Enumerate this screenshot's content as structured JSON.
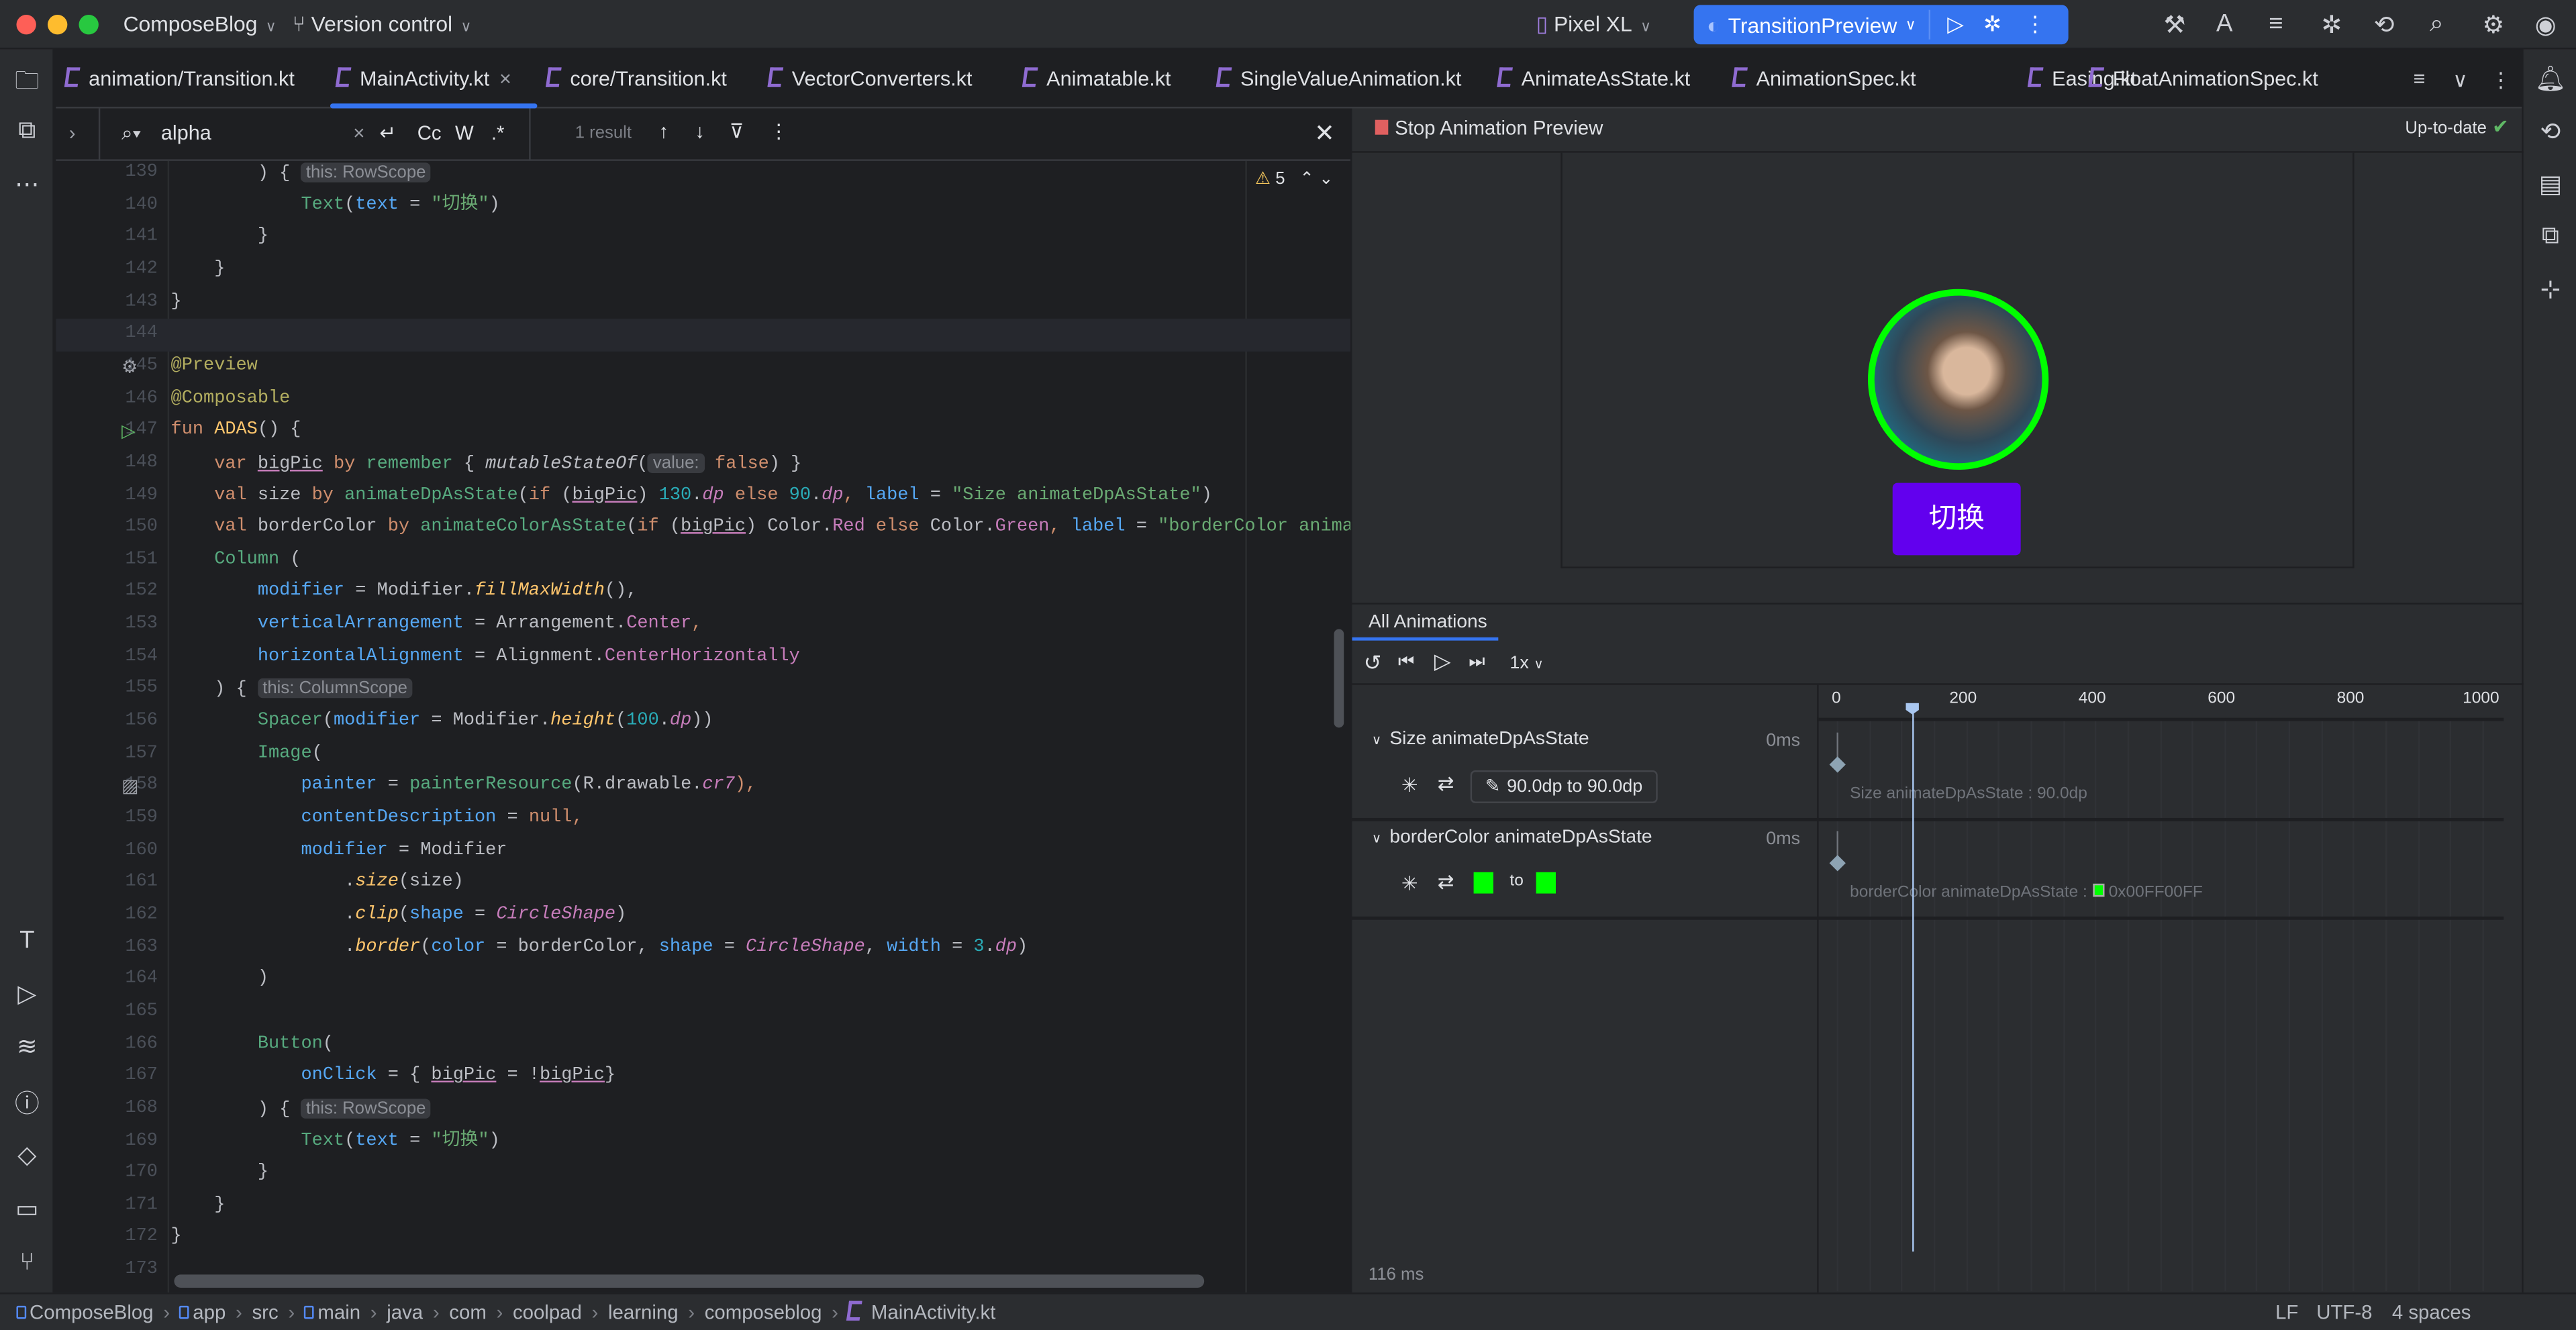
{
  "titlebar": {
    "project": "ComposeBlog",
    "vcs": "Version control",
    "device": "Pixel XL",
    "run_config": "TransitionPreview"
  },
  "tabs": [
    {
      "label": "animation/Transition.kt"
    },
    {
      "label": "MainActivity.kt",
      "active": true
    },
    {
      "label": "core/Transition.kt"
    },
    {
      "label": "VectorConverters.kt"
    },
    {
      "label": "Animatable.kt"
    },
    {
      "label": "SingleValueAnimation.kt"
    },
    {
      "label": "AnimateAsState.kt"
    },
    {
      "label": "AnimationSpec.kt"
    },
    {
      "label": "Easing.kt"
    },
    {
      "label": "FloatAnimationSpec.kt"
    }
  ],
  "find": {
    "query": "alpha",
    "case_label": "Cc",
    "word_label": "W",
    "regex_label": ".*",
    "result": "1 result"
  },
  "editor": {
    "warnings": "5",
    "lines": [
      {
        "n": "139",
        "t": [
          [
            "        ) {",
            "t"
          ],
          [
            " ",
            ""
          ],
          [
            "this: RowScope",
            "h"
          ]
        ]
      },
      {
        "n": "140",
        "t": [
          [
            "            ",
            ""
          ],
          [
            "Text",
            "f"
          ],
          [
            "(",
            ""
          ],
          [
            "text",
            "p"
          ],
          [
            " = ",
            ""
          ],
          [
            "\"切换\"",
            "s"
          ],
          [
            ")",
            ""
          ]
        ]
      },
      {
        "n": "141",
        "t": [
          [
            "        }",
            ""
          ]
        ]
      },
      {
        "n": "142",
        "t": [
          [
            "    }",
            ""
          ]
        ]
      },
      {
        "n": "143",
        "t": [
          [
            "}",
            ""
          ]
        ]
      },
      {
        "n": "144",
        "t": [],
        "cur": true
      },
      {
        "n": "145",
        "t": [
          [
            "@Preview",
            "a"
          ]
        ],
        "icon": "gear"
      },
      {
        "n": "146",
        "t": [
          [
            "@Composable",
            "a"
          ]
        ]
      },
      {
        "n": "147",
        "t": [
          [
            "fun ",
            "k"
          ],
          [
            "ADAS",
            "y"
          ],
          [
            "() {",
            ""
          ]
        ],
        "icon": "run"
      },
      {
        "n": "148",
        "t": [
          [
            "    ",
            ""
          ],
          [
            "var ",
            "k"
          ],
          [
            "bigPic",
            "u"
          ],
          [
            " by ",
            "k"
          ],
          [
            "remember",
            "f"
          ],
          [
            " { ",
            ""
          ],
          [
            "mutableStateOf",
            "i"
          ],
          [
            "(",
            ""
          ],
          [
            "value:",
            "h"
          ],
          [
            " ",
            ""
          ],
          [
            "false",
            "k"
          ],
          [
            ") }",
            ""
          ]
        ]
      },
      {
        "n": "149",
        "t": [
          [
            "    ",
            ""
          ],
          [
            "val ",
            "k"
          ],
          [
            "size",
            ""
          ],
          [
            " by ",
            "k"
          ],
          [
            "animateDpAsState",
            "f"
          ],
          [
            "(",
            ""
          ],
          [
            "if",
            "k"
          ],
          [
            " (",
            ""
          ],
          [
            "bigPic",
            "u"
          ],
          [
            ") ",
            ""
          ],
          [
            "130",
            "n"
          ],
          [
            ".",
            ""
          ],
          [
            "dp",
            "im"
          ],
          [
            " else ",
            "k"
          ],
          [
            "90",
            "n"
          ],
          [
            ".",
            ""
          ],
          [
            "dp",
            "im"
          ],
          [
            ", ",
            "k"
          ],
          [
            "label",
            "p"
          ],
          [
            " = ",
            ""
          ],
          [
            "\"Size animateDpAsState\"",
            "s"
          ],
          [
            ")",
            ""
          ]
        ]
      },
      {
        "n": "150",
        "t": [
          [
            "    ",
            ""
          ],
          [
            "val ",
            "k"
          ],
          [
            "borderColor",
            ""
          ],
          [
            " by ",
            "k"
          ],
          [
            "animateColorAsState",
            "f"
          ],
          [
            "(",
            ""
          ],
          [
            "if",
            "k"
          ],
          [
            " (",
            ""
          ],
          [
            "bigPic",
            "u"
          ],
          [
            ") Color.",
            ""
          ],
          [
            "Red",
            "m"
          ],
          [
            " else ",
            "k"
          ],
          [
            "Color.",
            ""
          ],
          [
            "Green",
            "m"
          ],
          [
            ", ",
            "k"
          ],
          [
            "label",
            "p"
          ],
          [
            " = ",
            ""
          ],
          [
            "\"borderColor animat",
            "s"
          ]
        ]
      },
      {
        "n": "151",
        "t": [
          [
            "    ",
            ""
          ],
          [
            "Column",
            "f"
          ],
          [
            " (",
            ""
          ]
        ]
      },
      {
        "n": "152",
        "t": [
          [
            "        ",
            ""
          ],
          [
            "modifier",
            "p"
          ],
          [
            " = Modifier.",
            ""
          ],
          [
            "fillMaxWidth",
            "e"
          ],
          [
            "(),",
            ""
          ]
        ]
      },
      {
        "n": "153",
        "t": [
          [
            "        ",
            ""
          ],
          [
            "verticalArrangement",
            "p"
          ],
          [
            " = Arrangement.",
            ""
          ],
          [
            "Center",
            "m"
          ],
          [
            ",",
            "k"
          ]
        ]
      },
      {
        "n": "154",
        "t": [
          [
            "        ",
            ""
          ],
          [
            "horizontalAlignment",
            "p"
          ],
          [
            " = Alignment.",
            ""
          ],
          [
            "CenterHorizontally",
            "m"
          ]
        ]
      },
      {
        "n": "155",
        "t": [
          [
            "    ) {",
            ""
          ],
          [
            " ",
            ""
          ],
          [
            "this: ColumnScope",
            "h"
          ]
        ]
      },
      {
        "n": "156",
        "t": [
          [
            "        ",
            ""
          ],
          [
            "Spacer",
            "f"
          ],
          [
            "(",
            ""
          ],
          [
            "modifier",
            "p"
          ],
          [
            " = Modifier.",
            ""
          ],
          [
            "height",
            "e"
          ],
          [
            "(",
            ""
          ],
          [
            "100",
            "n"
          ],
          [
            ".",
            ""
          ],
          [
            "dp",
            "im"
          ],
          [
            "))",
            ""
          ]
        ]
      },
      {
        "n": "157",
        "t": [
          [
            "        ",
            ""
          ],
          [
            "Image",
            "f"
          ],
          [
            "(",
            ""
          ]
        ]
      },
      {
        "n": "158",
        "t": [
          [
            "            ",
            ""
          ],
          [
            "painter",
            "p"
          ],
          [
            " = ",
            ""
          ],
          [
            "painterResource",
            "f"
          ],
          [
            "(R.drawable.",
            ""
          ],
          [
            "cr7",
            "im"
          ],
          [
            "),",
            "k"
          ]
        ],
        "icon": "image"
      },
      {
        "n": "159",
        "t": [
          [
            "            ",
            ""
          ],
          [
            "contentDescription",
            "p"
          ],
          [
            " = ",
            ""
          ],
          [
            "null",
            "k"
          ],
          [
            ",",
            "k"
          ]
        ]
      },
      {
        "n": "160",
        "t": [
          [
            "            ",
            ""
          ],
          [
            "modifier",
            "p"
          ],
          [
            " = Modifier",
            ""
          ]
        ]
      },
      {
        "n": "161",
        "t": [
          [
            "                .",
            ""
          ],
          [
            "size",
            "e"
          ],
          [
            "(size)",
            ""
          ]
        ]
      },
      {
        "n": "162",
        "t": [
          [
            "                .",
            ""
          ],
          [
            "clip",
            "e"
          ],
          [
            "(",
            ""
          ],
          [
            "shape",
            "p"
          ],
          [
            " = ",
            ""
          ],
          [
            "CircleShape",
            "im"
          ],
          [
            ")",
            ""
          ]
        ]
      },
      {
        "n": "163",
        "t": [
          [
            "                .",
            ""
          ],
          [
            "border",
            "e"
          ],
          [
            "(",
            ""
          ],
          [
            "color",
            "p"
          ],
          [
            " = borderColor, ",
            ""
          ],
          [
            "shape",
            "p"
          ],
          [
            " = ",
            ""
          ],
          [
            "CircleShape",
            "im"
          ],
          [
            ", ",
            ""
          ],
          [
            "width",
            "p"
          ],
          [
            " = ",
            ""
          ],
          [
            "3",
            "n"
          ],
          [
            ".",
            ""
          ],
          [
            "dp",
            "im"
          ],
          [
            ")",
            ""
          ]
        ]
      },
      {
        "n": "164",
        "t": [
          [
            "        )",
            ""
          ]
        ]
      },
      {
        "n": "165",
        "t": []
      },
      {
        "n": "166",
        "t": [
          [
            "        ",
            ""
          ],
          [
            "Button",
            "f"
          ],
          [
            "(",
            ""
          ]
        ]
      },
      {
        "n": "167",
        "t": [
          [
            "            ",
            ""
          ],
          [
            "onClick",
            "p"
          ],
          [
            " = { ",
            ""
          ],
          [
            "bigPic",
            "u"
          ],
          [
            " = !",
            ""
          ],
          [
            "bigPic",
            "u"
          ],
          [
            "}",
            ""
          ]
        ]
      },
      {
        "n": "168",
        "t": [
          [
            "        ) {",
            ""
          ],
          [
            " ",
            ""
          ],
          [
            "this: RowScope",
            "h"
          ]
        ]
      },
      {
        "n": "169",
        "t": [
          [
            "            ",
            ""
          ],
          [
            "Text",
            "f"
          ],
          [
            "(",
            ""
          ],
          [
            "text",
            "p"
          ],
          [
            " = ",
            ""
          ],
          [
            "\"切换\"",
            "s"
          ],
          [
            ")",
            ""
          ]
        ]
      },
      {
        "n": "170",
        "t": [
          [
            "        }",
            ""
          ]
        ]
      },
      {
        "n": "171",
        "t": [
          [
            "    }",
            ""
          ]
        ]
      },
      {
        "n": "172",
        "t": [
          [
            "}",
            ""
          ]
        ]
      },
      {
        "n": "173",
        "t": []
      }
    ]
  },
  "preview": {
    "stop_label": "Stop Animation Preview",
    "status": "Up-to-date",
    "button_label": "切换",
    "border_color": "#00FF00",
    "button_color": "#6200EE"
  },
  "animations": {
    "tab": "All Animations",
    "speed": "1x",
    "ticks": [
      "0",
      "200",
      "400",
      "600",
      "800",
      "1000"
    ],
    "tick_values": [
      0,
      200,
      400,
      600,
      800,
      1000
    ],
    "playhead_ms": 116,
    "rows": [
      {
        "name": "Size animateDpAsState",
        "duration": "0ms",
        "value_label": "90.0dp to 90.0dp",
        "track_label": "Size animateDpAsState : 90.0dp"
      },
      {
        "name": "borderColor animateDpAsState",
        "duration": "0ms",
        "to_label": "to",
        "from_color": "#00FF00",
        "to_color": "#00FF00",
        "track_label": "borderColor animateDpAsState :",
        "track_value": "0x00FF00FF"
      }
    ],
    "footer": "116 ms"
  },
  "statusbar": {
    "breadcrumbs": [
      "ComposeBlog",
      "app",
      "src",
      "main",
      "java",
      "com",
      "coolpad",
      "learning",
      "composeblog",
      "MainActivity.kt"
    ],
    "line_sep": "LF",
    "encoding": "UTF-8",
    "indent": "4 spaces"
  }
}
